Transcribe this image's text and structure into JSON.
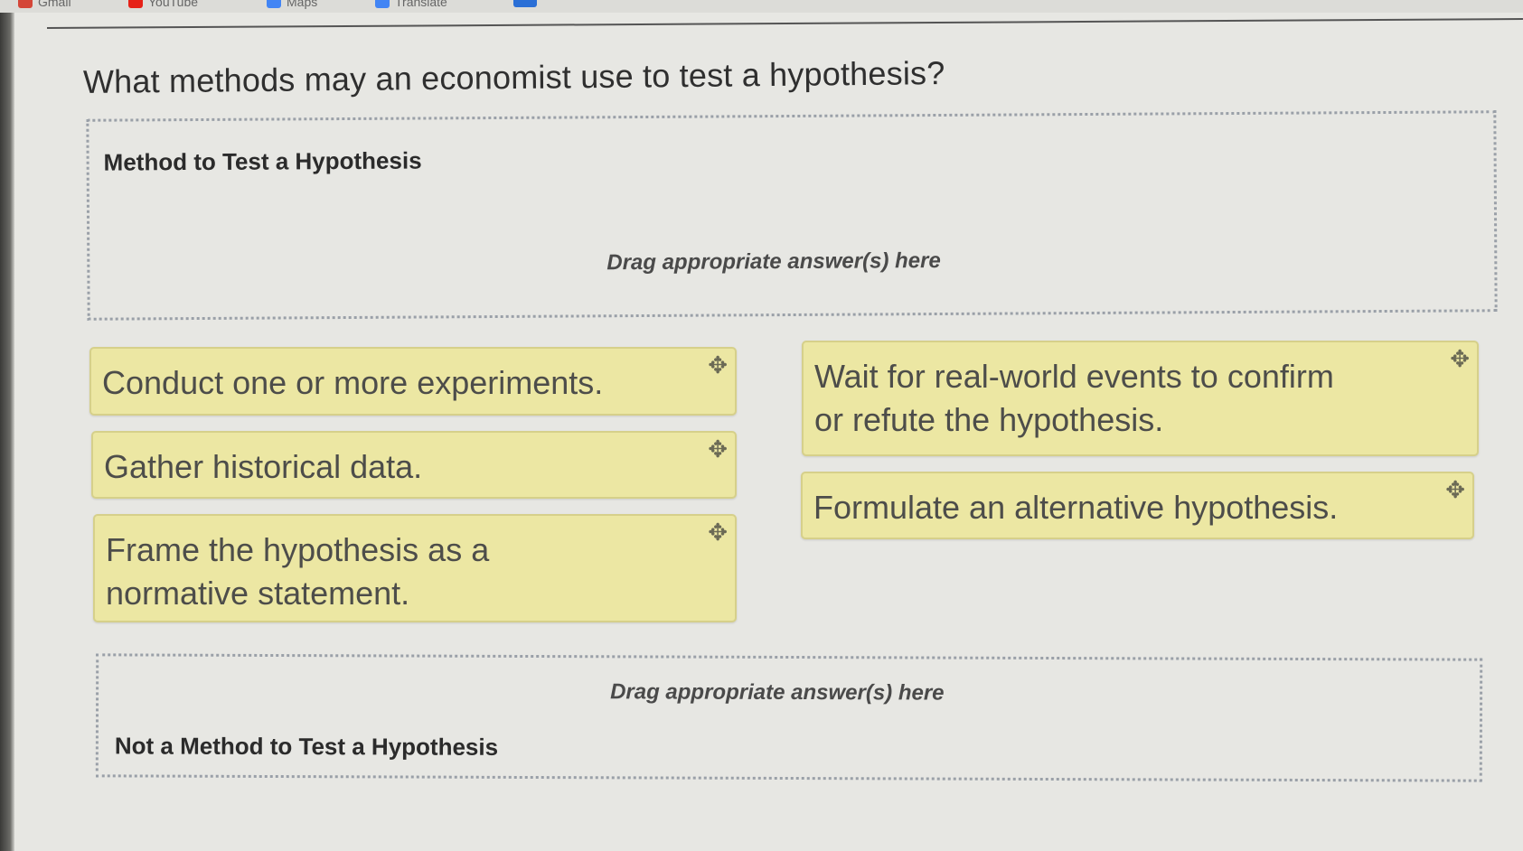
{
  "bookmarks": [
    {
      "label": "Gmail",
      "color": "#d44638"
    },
    {
      "label": "YouTube",
      "color": "#e62117"
    },
    {
      "label": "Maps",
      "color": "#4285f4"
    },
    {
      "label": "Translate",
      "color": "#4285f4"
    }
  ],
  "question": "What methods may an economist use to test a hypothesis?",
  "zones": {
    "method": {
      "title": "Method to Test a Hypothesis",
      "hint": "Drag appropriate answer(s) here"
    },
    "not_method": {
      "title": "Not a Method to Test a Hypothesis",
      "hint": "Drag appropriate answer(s) here"
    }
  },
  "cards": [
    "Conduct one or more experiments.",
    "Gather historical data.",
    "Frame the hypothesis as a normative statement.",
    "Wait for real-world events to confirm or refute the hypothesis.",
    "Formulate an alternative hypothesis."
  ],
  "move_icon": "move-icon",
  "colors": {
    "card_bg": "#ece7a3",
    "card_border": "#d6d08a",
    "zone_border": "#9aa0a8"
  }
}
